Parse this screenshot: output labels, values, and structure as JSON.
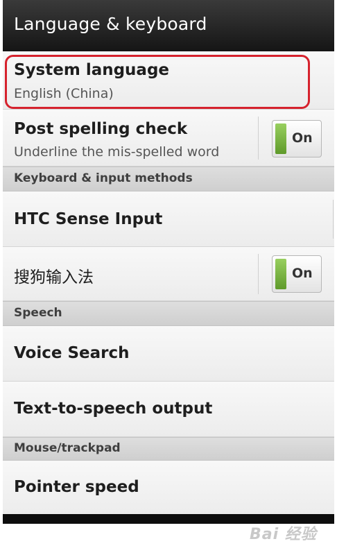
{
  "header": {
    "title": "Language & keyboard"
  },
  "items": {
    "system_language": {
      "title": "System language",
      "subtitle": "English (China)"
    },
    "post_spelling": {
      "title": "Post spelling check",
      "subtitle": "Underline the mis-spelled word",
      "toggle": "On"
    },
    "htc_sense": {
      "title": "HTC Sense Input"
    },
    "sogou": {
      "title": "搜狗输入法",
      "toggle": "On"
    },
    "voice_search": {
      "title": "Voice Search"
    },
    "tts": {
      "title": "Text-to-speech output"
    },
    "pointer_speed": {
      "title": "Pointer speed"
    }
  },
  "sections": {
    "keyboard": "Keyboard & input methods",
    "speech": "Speech",
    "mouse": "Mouse/trackpad"
  },
  "watermark": {
    "text": "Bai 经验"
  },
  "colors": {
    "highlight": "#d6222d",
    "toggle_on": "#6fb033"
  }
}
